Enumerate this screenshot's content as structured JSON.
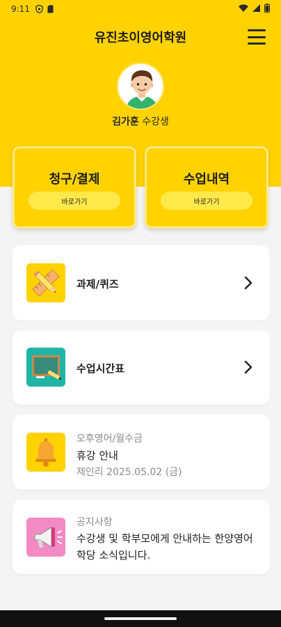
{
  "status": {
    "time": "9:11"
  },
  "header": {
    "title": "유진초이영어학원"
  },
  "profile": {
    "name": "김가훈",
    "role": "수강생"
  },
  "quick_actions": [
    {
      "label": "청구/결제",
      "button": "바로가기"
    },
    {
      "label": "수업내역",
      "button": "바로가기"
    }
  ],
  "menu": [
    {
      "label": "과제/퀴즈",
      "icon": "pencil-ruler-icon"
    },
    {
      "label": "수업시간표",
      "icon": "chalkboard-icon"
    }
  ],
  "notice": {
    "category": "오후영어/월수금",
    "title": "휴강 안내",
    "meta": "제인리 2025.05.02 (금)",
    "icon": "bell-icon"
  },
  "info": {
    "category": "공지사항",
    "message": "수강생 및 학부모에게 안내하는 한양영어학당 소식입니다.",
    "icon": "megaphone-icon"
  },
  "colors": {
    "brand_yellow": "#ffd200",
    "background": "#f4f4f4",
    "card": "#ffffff",
    "muted_text": "#8a8a8a"
  }
}
